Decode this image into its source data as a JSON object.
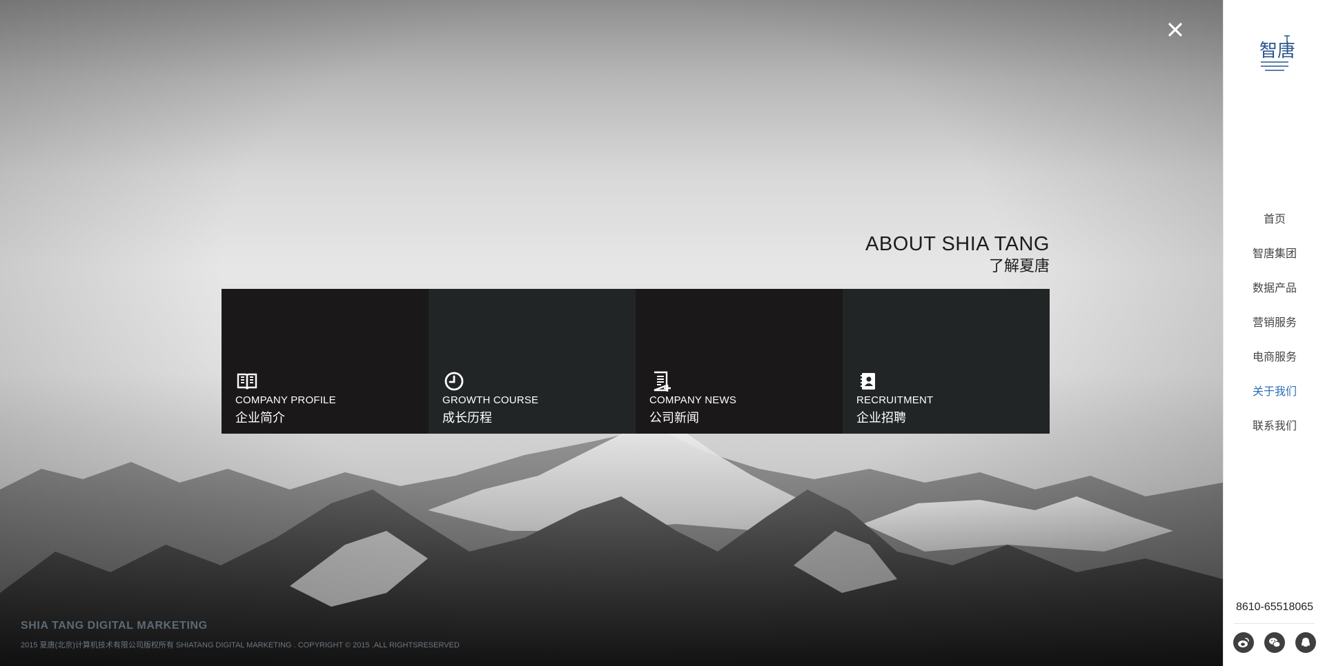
{
  "about": {
    "title_en": "ABOUT SHIA TANG",
    "title_cn": "了解夏唐"
  },
  "tiles": [
    {
      "en": "COMPANY PROFILE",
      "cn": "企业简介",
      "icon": "book-icon"
    },
    {
      "en": "GROWTH COURSE",
      "cn": "成长历程",
      "icon": "clock-icon"
    },
    {
      "en": "COMPANY NEWS",
      "cn": "公司新闻",
      "icon": "news-document-icon"
    },
    {
      "en": "RECRUITMENT",
      "cn": "企业招聘",
      "icon": "contact-book-icon"
    }
  ],
  "footer": {
    "brand": "SHIA TANG DIGITAL MARKETING",
    "copyright": "2015 夏唐(北京)计算机技术有限公司版权所有 SHIATANG DIGITAL MARKETING . COPYRIGHT © 2015 .ALL RIGHTSRESERVED"
  },
  "sidebar": {
    "logo_text": "智唐",
    "nav": [
      {
        "label": "首页"
      },
      {
        "label": "智唐集团"
      },
      {
        "label": "数据产品"
      },
      {
        "label": "营销服务"
      },
      {
        "label": "电商服务"
      },
      {
        "label": "关于我们",
        "active": true
      },
      {
        "label": "联系我们"
      }
    ],
    "phone": "8610-65518065",
    "socials": [
      "weibo-icon",
      "wechat-icon",
      "qq-icon"
    ]
  },
  "colors": {
    "accent": "#2b70b8",
    "tile_dark": "#1a1819",
    "tile_slate": "#222526",
    "footer_text": "#5d6a74"
  }
}
